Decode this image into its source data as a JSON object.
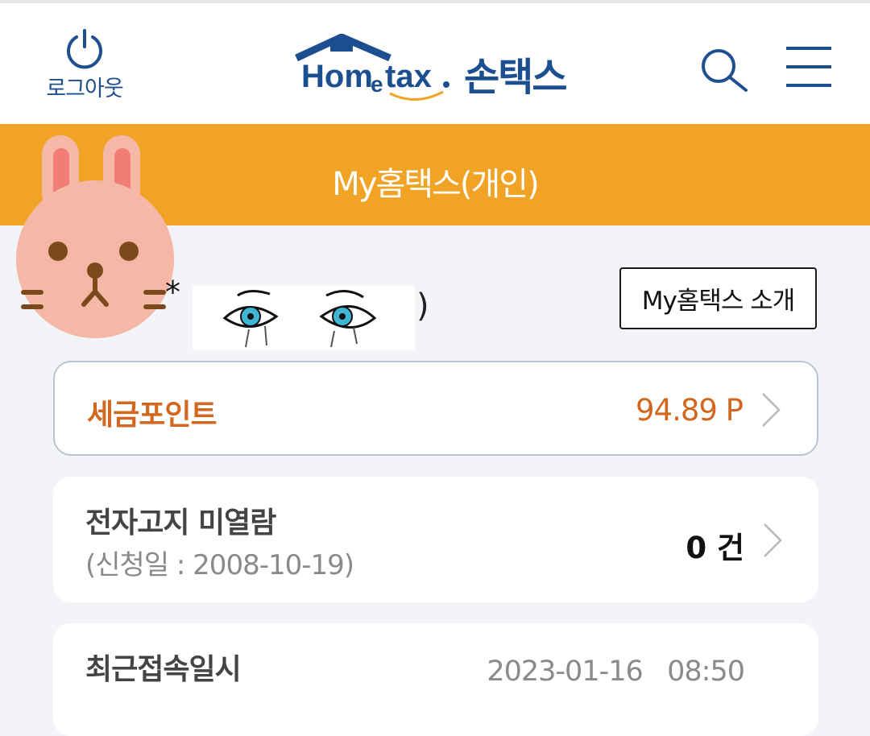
{
  "header": {
    "logout_label": "로그아웃",
    "brand_name": "손택스",
    "logo_text": "Hometax",
    "icons": [
      "power-icon",
      "search-icon",
      "hamburger-menu-icon"
    ]
  },
  "banner": {
    "title": "My홈택스(개인)"
  },
  "user": {
    "masked_prefix": "*",
    "paren_close": ")"
  },
  "intro_button": {
    "label": "My홈택스 소개"
  },
  "cards": [
    {
      "label": "세금포인트",
      "value": "94.89 P"
    },
    {
      "label": "전자고지 미열람",
      "sub": "(신청일 : 2008-10-19)",
      "value": "0 건"
    },
    {
      "label": "최근접속일시",
      "value": "2023-01-16   08:50"
    }
  ],
  "colors": {
    "banner": "#f1a326",
    "brand_blue": "#1b4f8f",
    "point_orange": "#d2671f"
  }
}
